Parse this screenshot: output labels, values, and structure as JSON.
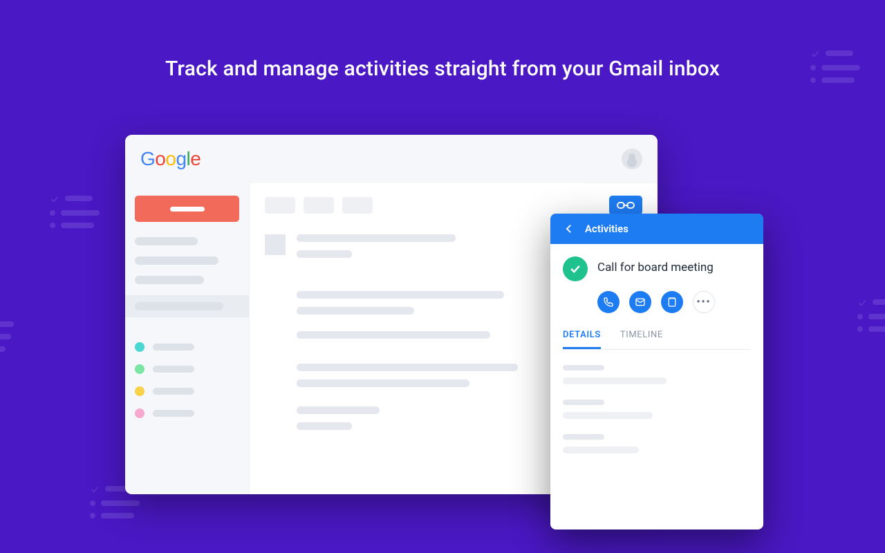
{
  "headline": "Track and manage activities straight from your Gmail inbox",
  "header": {
    "logo_text": "Google"
  },
  "sidebar": {
    "label_colors": [
      "#4ad7d1",
      "#7be6a4",
      "#f9d24a",
      "#f6a8cf"
    ]
  },
  "extension": {
    "icon": "link-chain-icon"
  },
  "panel": {
    "header_title": "Activities",
    "activity_title": "Call for board meeting",
    "action_icons": [
      "phone-icon",
      "mail-icon",
      "notes-icon",
      "more-icon"
    ],
    "tabs": [
      {
        "label": "DETAILS",
        "active": true
      },
      {
        "label": "TIMELINE",
        "active": false
      }
    ]
  }
}
